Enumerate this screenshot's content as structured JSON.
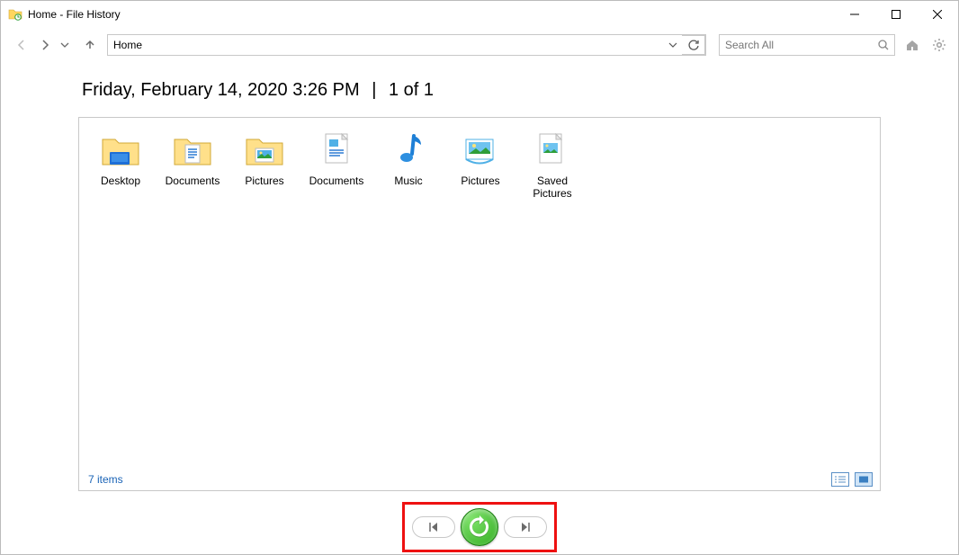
{
  "window": {
    "title": "Home - File History"
  },
  "nav": {
    "address": "Home"
  },
  "search": {
    "placeholder": "Search All"
  },
  "heading": {
    "timestamp": "Friday, February 14, 2020 3:26 PM",
    "sep": "|",
    "pager": "1 of 1"
  },
  "items": [
    {
      "label": "Desktop",
      "icon": "folder-desktop"
    },
    {
      "label": "Documents",
      "icon": "folder-documents"
    },
    {
      "label": "Pictures",
      "icon": "folder-pictures"
    },
    {
      "label": "Documents",
      "icon": "library-documents"
    },
    {
      "label": "Music",
      "icon": "library-music"
    },
    {
      "label": "Pictures",
      "icon": "library-pictures"
    },
    {
      "label": "Saved Pictures",
      "icon": "library-saved-pictures"
    }
  ],
  "status": {
    "count": "7 items"
  }
}
